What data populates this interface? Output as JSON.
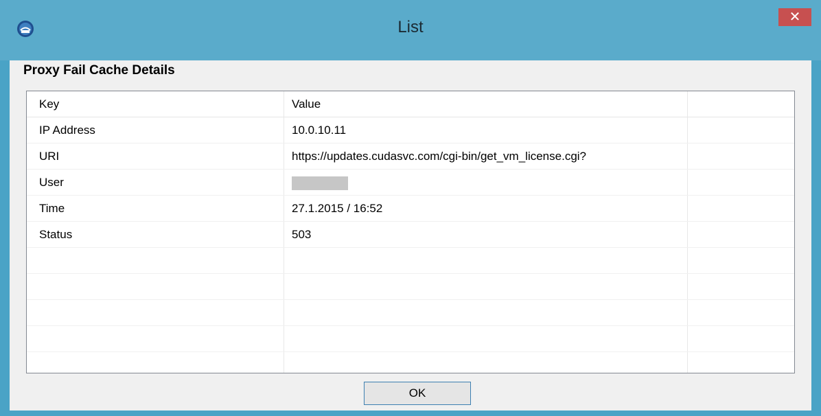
{
  "window": {
    "title": "List",
    "close_glyph": "✕"
  },
  "heading": "Proxy Fail Cache Details",
  "list": {
    "headers": {
      "key": "Key",
      "value": "Value"
    },
    "rows": [
      {
        "key": "IP Address",
        "value": "10.0.10.11"
      },
      {
        "key": "URI",
        "value": "https://updates.cudasvc.com/cgi-bin/get_vm_license.cgi?"
      },
      {
        "key": "User",
        "value": "",
        "redacted": true
      },
      {
        "key": "Time",
        "value": "27.1.2015 / 16:52"
      },
      {
        "key": "Status",
        "value": "503"
      }
    ]
  },
  "buttons": {
    "ok": "OK"
  },
  "icons": {
    "app": "app-globe-icon",
    "close": "close-icon"
  },
  "colors": {
    "titlebar": "#5aabcb",
    "close": "#c75050",
    "dialog_bg": "#f0f0f0"
  }
}
